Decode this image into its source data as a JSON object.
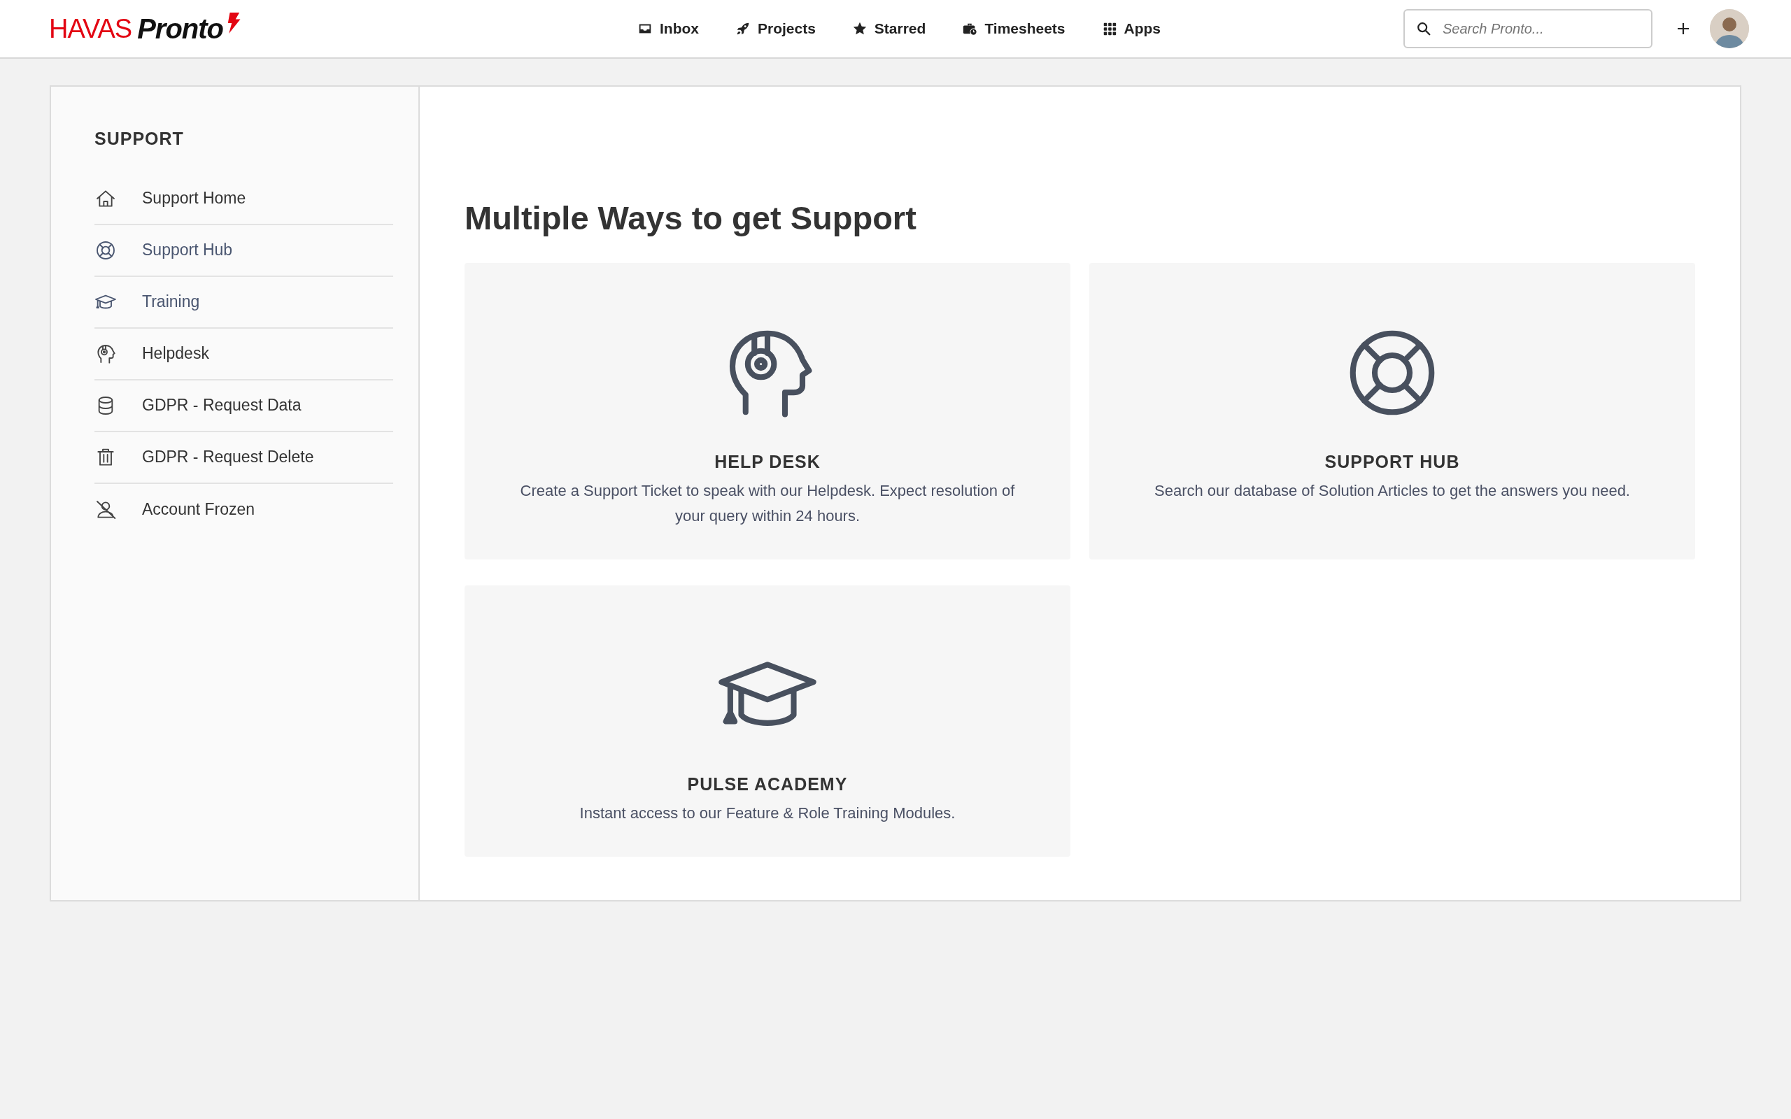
{
  "header": {
    "logo": {
      "brand": "HAVAS",
      "product": "Pronto"
    },
    "nav": [
      {
        "label": "Inbox"
      },
      {
        "label": "Projects"
      },
      {
        "label": "Starred"
      },
      {
        "label": "Timesheets"
      },
      {
        "label": "Apps"
      }
    ],
    "search": {
      "placeholder": "Search Pronto..."
    }
  },
  "sidebar": {
    "title": "SUPPORT",
    "items": [
      {
        "label": "Support Home",
        "visited": false
      },
      {
        "label": "Support Hub",
        "visited": true
      },
      {
        "label": "Training",
        "visited": true
      },
      {
        "label": "Helpdesk",
        "visited": false
      },
      {
        "label": "GDPR - Request Data",
        "visited": false
      },
      {
        "label": "GDPR - Request Delete",
        "visited": false
      },
      {
        "label": "Account Frozen",
        "visited": false
      }
    ]
  },
  "content": {
    "heading": "Multiple Ways to get Support",
    "cards": [
      {
        "title": "HELP DESK",
        "description": "Create a Support Ticket to speak with our Helpdesk. Expect resolution of your query within 24 hours."
      },
      {
        "title": "SUPPORT HUB",
        "description": "Search our database of Solution Articles to get the answers you need."
      },
      {
        "title": "PULSE ACADEMY",
        "description": "Instant access to our Feature & Role Training Modules."
      }
    ]
  }
}
